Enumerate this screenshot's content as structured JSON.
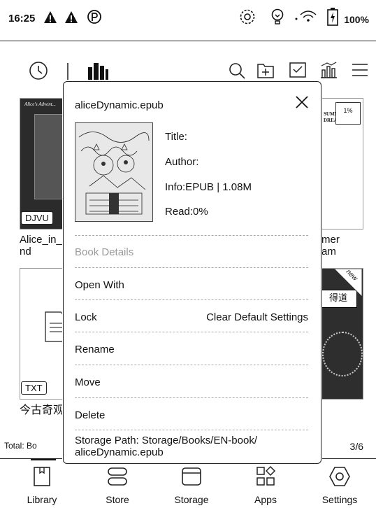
{
  "status_bar": {
    "time": "16:25",
    "battery": "100%",
    "icons": [
      "alert-icon",
      "alert-icon",
      "p-icon",
      "sync-icon",
      "bulb-icon",
      "wifi-icon",
      "battery-icon"
    ]
  },
  "toolbar": {
    "icons": [
      "history-icon",
      "bookshelf-icon",
      "search-icon",
      "new-folder-icon",
      "select-icon",
      "statistics-icon",
      "menu-icon"
    ]
  },
  "books": [
    {
      "cover_text": "Alice's Advent...",
      "tag": "DJVU",
      "title_lines": [
        "Alice_in_",
        "nd"
      ]
    },
    {
      "cover_text": "",
      "tag": "TXT",
      "title_lines": [
        "今古奇观"
      ]
    },
    {
      "cover_text": "SUMMER DREAM",
      "progress": "1%",
      "title_lines": [
        "mer",
        "am"
      ]
    },
    {
      "cover_text": "得道",
      "badge": "new",
      "title_lines": []
    }
  ],
  "footer": {
    "total": "Total: Bo",
    "pager": "3/6"
  },
  "nav": [
    {
      "label": "Library",
      "icon": "library-icon"
    },
    {
      "label": "Store",
      "icon": "store-icon"
    },
    {
      "label": "Storage",
      "icon": "storage-icon"
    },
    {
      "label": "Apps",
      "icon": "apps-icon"
    },
    {
      "label": "Settings",
      "icon": "settings-icon"
    }
  ],
  "popup": {
    "filename": "aliceDynamic.epub",
    "title_label": "Title:",
    "author_label": "Author:",
    "info": "Info:EPUB | 1.08M",
    "read": "Read:0%",
    "menu": {
      "book_details": "Book Details",
      "open_with": "Open With",
      "lock": "Lock",
      "clear_default": "Clear Default Settings",
      "rename": "Rename",
      "move": "Move",
      "delete": "Delete"
    },
    "storage_path_line1": "Storage Path: Storage/Books/EN-book/",
    "storage_path_line2": "aliceDynamic.epub"
  }
}
